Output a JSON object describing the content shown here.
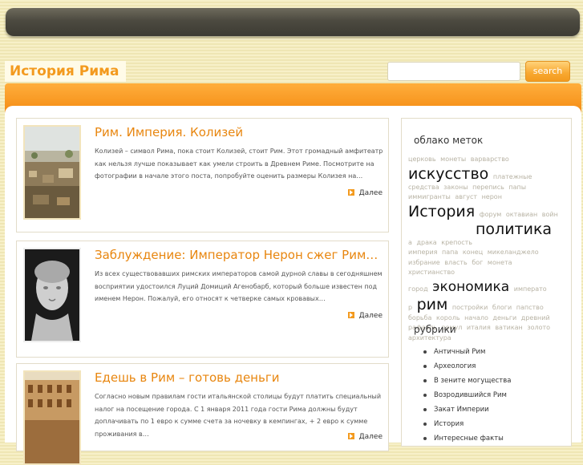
{
  "site": {
    "title": "История Рима"
  },
  "search": {
    "button": "search",
    "placeholder": ""
  },
  "posts": [
    {
      "title": "Рим. Империя. Колизей",
      "excerpt": "Колизей – символ Рима, пока стоит Колизей, стоит Рим. Этот громадный амфитеатр как нельзя лучше показывает как умели строить в Древнем Риме. Посмотрите на фотографии в начале этого поста, попробуйте оценить размеры Колизея на…",
      "more": "Далее"
    },
    {
      "title": "Заблуждение: Император Нерон сжег Рим…",
      "excerpt": "Из всех существовавших римских императоров самой дурной славы в сегодняшнем восприятии удостоился Луций Домиций Агенобарб, который больше известен под именем Нерон. Пожалуй, его относят к четверке самых кровавых…",
      "more": "Далее"
    },
    {
      "title": "Едешь в Рим – готовь деньги",
      "excerpt": "Согласно новым правилам гости итальянской столицы будут платить специальный налог на посещение города. С 1 января 2011 года гости Рима должны будут доплачивать по 1 евро к сумме счета за ночевку в кемпингах, + 2 евро к сумме проживания в…",
      "more": "Далее"
    }
  ],
  "sidebar": {
    "tags_heading": "облако меток",
    "tags": {
      "line1": [
        "церковь",
        "монеты",
        "варварство"
      ],
      "big1": "искусство",
      "line2a": "платежные",
      "line2": [
        "средства",
        "законы",
        "перепись",
        "папы"
      ],
      "line3": [
        "иммигранты",
        "август",
        "нерон"
      ],
      "big2": "История",
      "line4": [
        "форум",
        "октавиан",
        "войн"
      ],
      "big3": "политика",
      "line5": [
        "а",
        "драка",
        "крепость"
      ],
      "line6": [
        "империя",
        "папа",
        "конец",
        "микеланджело"
      ],
      "line7": [
        "избрание",
        "власть",
        "бог",
        "монета",
        "христианство"
      ],
      "line8a": "город",
      "big4": "экономика",
      "line8b": "императо",
      "line9a": "р",
      "big5": "рим",
      "line9b": [
        "постройки",
        "блоги",
        "папство"
      ],
      "line10": [
        "борьба",
        "король",
        "начало",
        "деньги",
        "древний"
      ],
      "line11": [
        "рафаэль",
        "ромул",
        "италия",
        "ватикан",
        "золото"
      ],
      "line12": [
        "архитектура"
      ]
    },
    "categories_heading": "рубрики",
    "categories": [
      "Античный Рим",
      "Археология",
      "В зените могущества",
      "Возродившийся Рим",
      "Закат Империи",
      "История",
      "Интересные факты"
    ]
  }
}
